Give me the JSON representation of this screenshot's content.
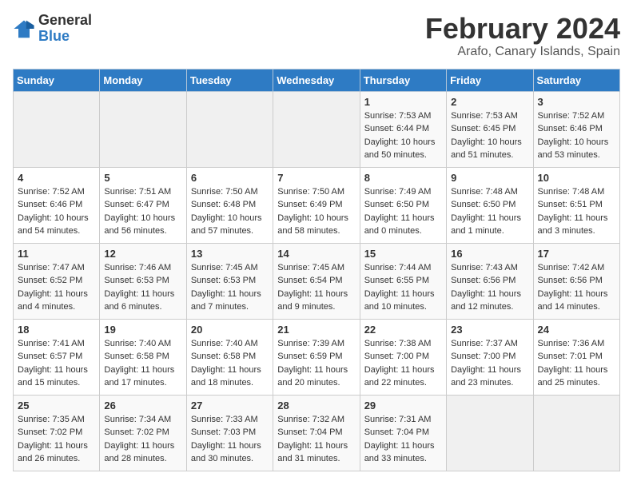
{
  "header": {
    "logo_general": "General",
    "logo_blue": "Blue",
    "month_title": "February 2024",
    "subtitle": "Arafo, Canary Islands, Spain"
  },
  "days_of_week": [
    "Sunday",
    "Monday",
    "Tuesday",
    "Wednesday",
    "Thursday",
    "Friday",
    "Saturday"
  ],
  "weeks": [
    [
      {
        "day": "",
        "info": ""
      },
      {
        "day": "",
        "info": ""
      },
      {
        "day": "",
        "info": ""
      },
      {
        "day": "",
        "info": ""
      },
      {
        "day": "1",
        "info": "Sunrise: 7:53 AM\nSunset: 6:44 PM\nDaylight: 10 hours\nand 50 minutes."
      },
      {
        "day": "2",
        "info": "Sunrise: 7:53 AM\nSunset: 6:45 PM\nDaylight: 10 hours\nand 51 minutes."
      },
      {
        "day": "3",
        "info": "Sunrise: 7:52 AM\nSunset: 6:46 PM\nDaylight: 10 hours\nand 53 minutes."
      }
    ],
    [
      {
        "day": "4",
        "info": "Sunrise: 7:52 AM\nSunset: 6:46 PM\nDaylight: 10 hours\nand 54 minutes."
      },
      {
        "day": "5",
        "info": "Sunrise: 7:51 AM\nSunset: 6:47 PM\nDaylight: 10 hours\nand 56 minutes."
      },
      {
        "day": "6",
        "info": "Sunrise: 7:50 AM\nSunset: 6:48 PM\nDaylight: 10 hours\nand 57 minutes."
      },
      {
        "day": "7",
        "info": "Sunrise: 7:50 AM\nSunset: 6:49 PM\nDaylight: 10 hours\nand 58 minutes."
      },
      {
        "day": "8",
        "info": "Sunrise: 7:49 AM\nSunset: 6:50 PM\nDaylight: 11 hours\nand 0 minutes."
      },
      {
        "day": "9",
        "info": "Sunrise: 7:48 AM\nSunset: 6:50 PM\nDaylight: 11 hours\nand 1 minute."
      },
      {
        "day": "10",
        "info": "Sunrise: 7:48 AM\nSunset: 6:51 PM\nDaylight: 11 hours\nand 3 minutes."
      }
    ],
    [
      {
        "day": "11",
        "info": "Sunrise: 7:47 AM\nSunset: 6:52 PM\nDaylight: 11 hours\nand 4 minutes."
      },
      {
        "day": "12",
        "info": "Sunrise: 7:46 AM\nSunset: 6:53 PM\nDaylight: 11 hours\nand 6 minutes."
      },
      {
        "day": "13",
        "info": "Sunrise: 7:45 AM\nSunset: 6:53 PM\nDaylight: 11 hours\nand 7 minutes."
      },
      {
        "day": "14",
        "info": "Sunrise: 7:45 AM\nSunset: 6:54 PM\nDaylight: 11 hours\nand 9 minutes."
      },
      {
        "day": "15",
        "info": "Sunrise: 7:44 AM\nSunset: 6:55 PM\nDaylight: 11 hours\nand 10 minutes."
      },
      {
        "day": "16",
        "info": "Sunrise: 7:43 AM\nSunset: 6:56 PM\nDaylight: 11 hours\nand 12 minutes."
      },
      {
        "day": "17",
        "info": "Sunrise: 7:42 AM\nSunset: 6:56 PM\nDaylight: 11 hours\nand 14 minutes."
      }
    ],
    [
      {
        "day": "18",
        "info": "Sunrise: 7:41 AM\nSunset: 6:57 PM\nDaylight: 11 hours\nand 15 minutes."
      },
      {
        "day": "19",
        "info": "Sunrise: 7:40 AM\nSunset: 6:58 PM\nDaylight: 11 hours\nand 17 minutes."
      },
      {
        "day": "20",
        "info": "Sunrise: 7:40 AM\nSunset: 6:58 PM\nDaylight: 11 hours\nand 18 minutes."
      },
      {
        "day": "21",
        "info": "Sunrise: 7:39 AM\nSunset: 6:59 PM\nDaylight: 11 hours\nand 20 minutes."
      },
      {
        "day": "22",
        "info": "Sunrise: 7:38 AM\nSunset: 7:00 PM\nDaylight: 11 hours\nand 22 minutes."
      },
      {
        "day": "23",
        "info": "Sunrise: 7:37 AM\nSunset: 7:00 PM\nDaylight: 11 hours\nand 23 minutes."
      },
      {
        "day": "24",
        "info": "Sunrise: 7:36 AM\nSunset: 7:01 PM\nDaylight: 11 hours\nand 25 minutes."
      }
    ],
    [
      {
        "day": "25",
        "info": "Sunrise: 7:35 AM\nSunset: 7:02 PM\nDaylight: 11 hours\nand 26 minutes."
      },
      {
        "day": "26",
        "info": "Sunrise: 7:34 AM\nSunset: 7:02 PM\nDaylight: 11 hours\nand 28 minutes."
      },
      {
        "day": "27",
        "info": "Sunrise: 7:33 AM\nSunset: 7:03 PM\nDaylight: 11 hours\nand 30 minutes."
      },
      {
        "day": "28",
        "info": "Sunrise: 7:32 AM\nSunset: 7:04 PM\nDaylight: 11 hours\nand 31 minutes."
      },
      {
        "day": "29",
        "info": "Sunrise: 7:31 AM\nSunset: 7:04 PM\nDaylight: 11 hours\nand 33 minutes."
      },
      {
        "day": "",
        "info": ""
      },
      {
        "day": "",
        "info": ""
      }
    ]
  ]
}
